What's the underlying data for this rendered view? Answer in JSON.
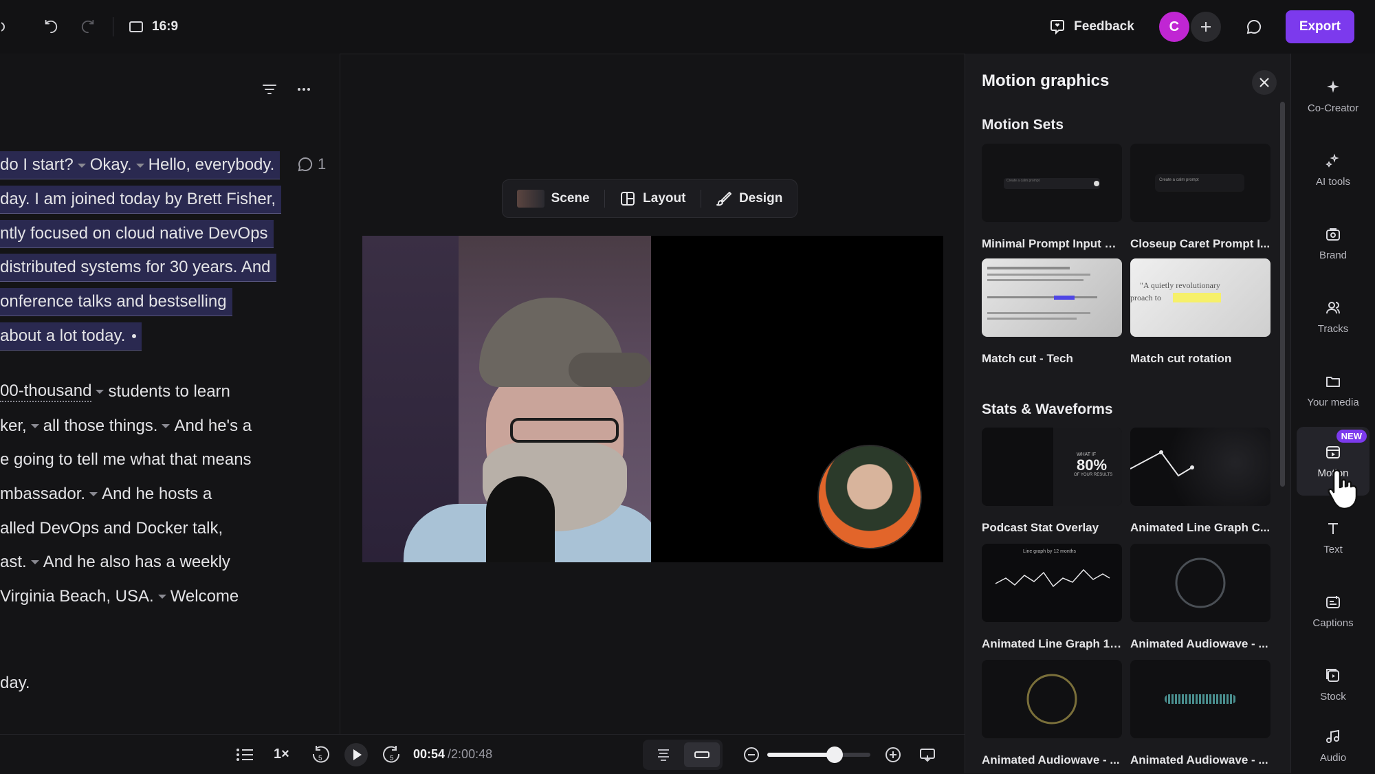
{
  "topbar": {
    "aspect_ratio": "16:9",
    "feedback_label": "Feedback",
    "avatar_initial": "C",
    "export_label": "Export"
  },
  "transcript": {
    "paragraph1": [
      {
        "text": "do I start?",
        "caret_after": true
      },
      {
        "text": "Okay.",
        "caret_after": true
      },
      {
        "text": "Hello, everybody."
      },
      {
        "text": "day. I am joined today by Brett Fisher,"
      },
      {
        "text": "ntly focused on cloud native DevOps"
      },
      {
        "text": "distributed systems for 30 years. And"
      },
      {
        "text": "onference talks and bestselling"
      },
      {
        "text": "about a lot today."
      }
    ],
    "comment_count": "1",
    "paragraph2": {
      "l1_a": "00-thousand",
      "l1_b": "students to learn",
      "l2_a": "ker,",
      "l2_b": "all those things.",
      "l2_c": "And he's a",
      "l3": "e going to tell me what that means",
      "l4_a": "mbassador.",
      "l4_b": "And he hosts a",
      "l5": "alled DevOps and Docker  talk,",
      "l6_a": "ast.",
      "l6_b": "And he also has a weekly",
      "l7_a": " Virginia Beach, USA.",
      "l7_b": "Welcome"
    },
    "paragraph3": "day."
  },
  "scene_bar": {
    "scene_label": "Scene",
    "layout_label": "Layout",
    "design_label": "Design"
  },
  "playback": {
    "speed": "1×",
    "rewind_seconds": "5",
    "forward_seconds": "5",
    "current_time": "00:54",
    "total_time": "/2:00:48",
    "zoom_level": 0.65
  },
  "panel": {
    "title": "Motion graphics",
    "sections": [
      {
        "title": "Motion Sets",
        "items": [
          {
            "label": "Minimal Prompt Input Fi..."
          },
          {
            "label": "Closeup Caret Prompt I..."
          },
          {
            "label": "Match cut - Tech"
          },
          {
            "label": "Match cut rotation"
          }
        ]
      },
      {
        "title": "Stats & Waveforms",
        "items": [
          {
            "label": "Podcast Stat Overlay"
          },
          {
            "label": "Animated Line Graph C..."
          },
          {
            "label": "Animated Line Graph 12..."
          },
          {
            "label": "Animated Audiowave - ..."
          },
          {
            "label": "Animated Audiowave - ..."
          },
          {
            "label": "Animated Audiowave - ..."
          }
        ]
      }
    ],
    "thumb_text": {
      "prompt_text": "Create a calm prompt",
      "match_quote": "\"A quietly revolutionary",
      "match_quote2": "proach to",
      "stat_value": "80%",
      "stat_top": "WHAT IF",
      "stat_bottom": "OF YOUR RESULTS",
      "graph_title": "Line graph by 12 months"
    }
  },
  "rail": {
    "items": [
      {
        "label": "Co-Creator"
      },
      {
        "label": "AI tools"
      },
      {
        "label": "Brand"
      },
      {
        "label": "Tracks"
      },
      {
        "label": "Your media"
      },
      {
        "label": "Motion",
        "badge": "NEW"
      },
      {
        "label": "Text"
      },
      {
        "label": "Captions"
      },
      {
        "label": "Stock"
      },
      {
        "label": "Audio"
      }
    ]
  },
  "colors": {
    "accent": "#7c3aed",
    "avatar": "#c026d3",
    "highlight": "#2a2950"
  }
}
